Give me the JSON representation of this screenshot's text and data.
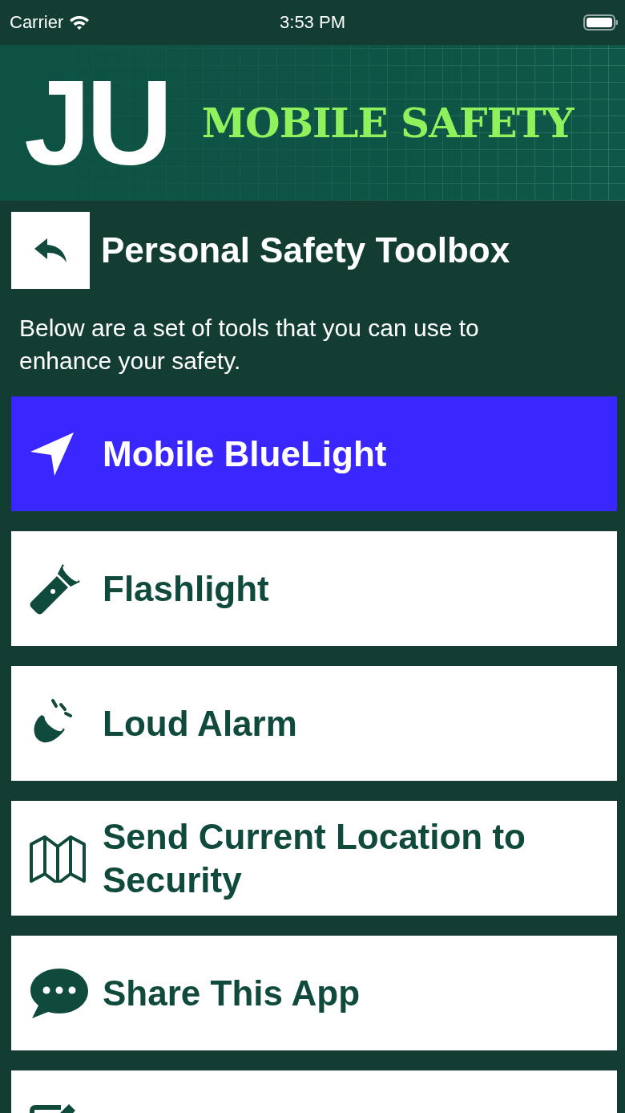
{
  "status_bar": {
    "carrier": "Carrier",
    "time": "3:53 PM"
  },
  "banner": {
    "logo": "JU",
    "title": "MOBILE SAFETY"
  },
  "header": {
    "title": "Personal Safety Toolbox"
  },
  "description": "Below are a set of tools that you can use to enhance your safety.",
  "tools": [
    {
      "kind": "navigate",
      "label": "Mobile BlueLight",
      "highlighted": true
    },
    {
      "kind": "flashlight",
      "label": "Flashlight",
      "highlighted": false
    },
    {
      "kind": "alarm",
      "label": "Loud Alarm",
      "highlighted": false
    },
    {
      "kind": "map",
      "label": "Send Current Location to Security",
      "highlighted": false
    },
    {
      "kind": "chat",
      "label": "Share This App",
      "highlighted": false
    },
    {
      "kind": "edit",
      "highlighted": false
    }
  ]
}
